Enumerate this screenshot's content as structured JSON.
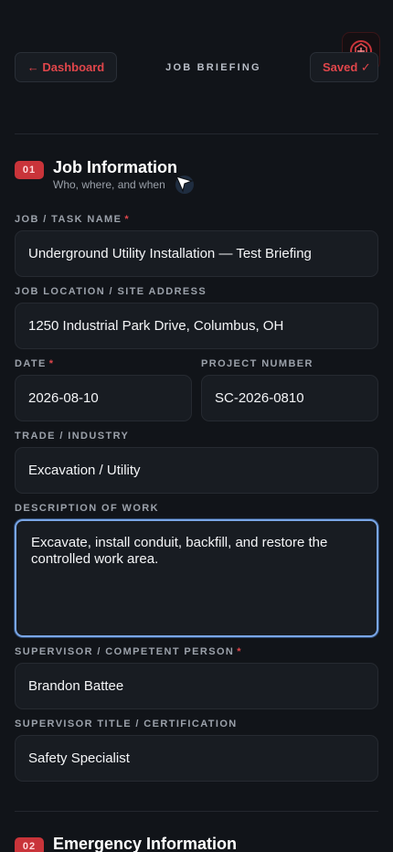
{
  "header": {
    "back_label": "← Dashboard",
    "title": "JOB BRIEFING",
    "saved_label": "Saved ✓"
  },
  "section1": {
    "badge": "01",
    "title": "Job Information",
    "subtitle": "Who, where, and when"
  },
  "fields": {
    "job_name": {
      "label": "JOB / TASK NAME",
      "required": "*",
      "value": "Underground Utility Installation — Test Briefing"
    },
    "location": {
      "label": "JOB LOCATION / SITE ADDRESS",
      "value": "1250 Industrial Park Drive, Columbus, OH"
    },
    "date": {
      "label": "DATE",
      "required": "*",
      "value": "2026-08-10"
    },
    "project_number": {
      "label": "PROJECT NUMBER",
      "value": "SC-2026-0810"
    },
    "trade": {
      "label": "TRADE / INDUSTRY",
      "value": "Excavation / Utility"
    },
    "description": {
      "label": "DESCRIPTION OF WORK",
      "value": "Excavate, install conduit, backfill, and restore the controlled work area."
    },
    "supervisor": {
      "label": "SUPERVISOR / COMPETENT PERSON",
      "required": "*",
      "value": "Brandon Battee"
    },
    "supervisor_title": {
      "label": "SUPERVISOR TITLE / CERTIFICATION",
      "value": "Safety Specialist"
    }
  },
  "section2": {
    "badge": "02",
    "title": "Emergency Information"
  },
  "colors": {
    "accent": "#e0464b",
    "background": "#111419",
    "field_bg": "#181c22",
    "focus_border": "#7aa6e6"
  }
}
